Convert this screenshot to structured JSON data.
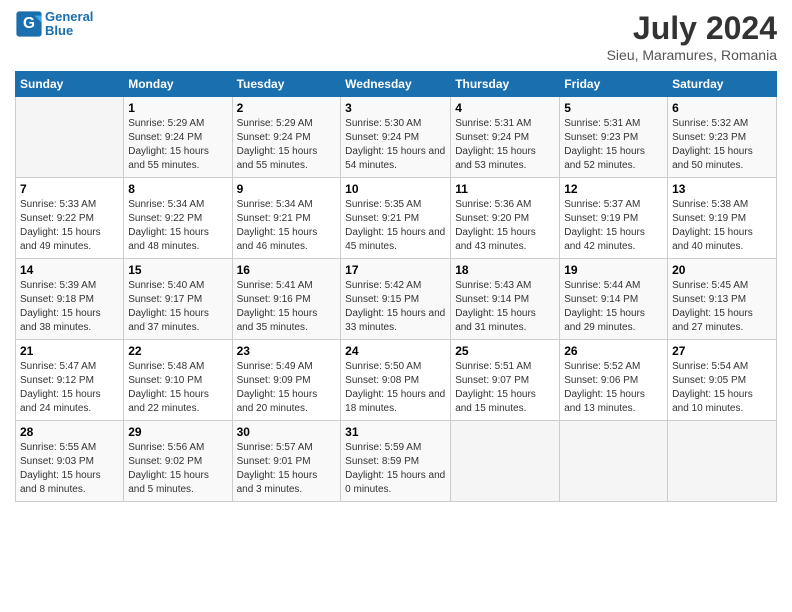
{
  "header": {
    "logo_text_general": "General",
    "logo_text_blue": "Blue",
    "month_year": "July 2024",
    "location": "Sieu, Maramures, Romania"
  },
  "days_of_week": [
    "Sunday",
    "Monday",
    "Tuesday",
    "Wednesday",
    "Thursday",
    "Friday",
    "Saturday"
  ],
  "weeks": [
    [
      null,
      {
        "num": "1",
        "sunrise": "5:29 AM",
        "sunset": "9:24 PM",
        "daylight": "15 hours and 55 minutes."
      },
      {
        "num": "2",
        "sunrise": "5:29 AM",
        "sunset": "9:24 PM",
        "daylight": "15 hours and 55 minutes."
      },
      {
        "num": "3",
        "sunrise": "5:30 AM",
        "sunset": "9:24 PM",
        "daylight": "15 hours and 54 minutes."
      },
      {
        "num": "4",
        "sunrise": "5:31 AM",
        "sunset": "9:24 PM",
        "daylight": "15 hours and 53 minutes."
      },
      {
        "num": "5",
        "sunrise": "5:31 AM",
        "sunset": "9:23 PM",
        "daylight": "15 hours and 52 minutes."
      },
      {
        "num": "6",
        "sunrise": "5:32 AM",
        "sunset": "9:23 PM",
        "daylight": "15 hours and 50 minutes."
      }
    ],
    [
      {
        "num": "7",
        "sunrise": "5:33 AM",
        "sunset": "9:22 PM",
        "daylight": "15 hours and 49 minutes."
      },
      {
        "num": "8",
        "sunrise": "5:34 AM",
        "sunset": "9:22 PM",
        "daylight": "15 hours and 48 minutes."
      },
      {
        "num": "9",
        "sunrise": "5:34 AM",
        "sunset": "9:21 PM",
        "daylight": "15 hours and 46 minutes."
      },
      {
        "num": "10",
        "sunrise": "5:35 AM",
        "sunset": "9:21 PM",
        "daylight": "15 hours and 45 minutes."
      },
      {
        "num": "11",
        "sunrise": "5:36 AM",
        "sunset": "9:20 PM",
        "daylight": "15 hours and 43 minutes."
      },
      {
        "num": "12",
        "sunrise": "5:37 AM",
        "sunset": "9:19 PM",
        "daylight": "15 hours and 42 minutes."
      },
      {
        "num": "13",
        "sunrise": "5:38 AM",
        "sunset": "9:19 PM",
        "daylight": "15 hours and 40 minutes."
      }
    ],
    [
      {
        "num": "14",
        "sunrise": "5:39 AM",
        "sunset": "9:18 PM",
        "daylight": "15 hours and 38 minutes."
      },
      {
        "num": "15",
        "sunrise": "5:40 AM",
        "sunset": "9:17 PM",
        "daylight": "15 hours and 37 minutes."
      },
      {
        "num": "16",
        "sunrise": "5:41 AM",
        "sunset": "9:16 PM",
        "daylight": "15 hours and 35 minutes."
      },
      {
        "num": "17",
        "sunrise": "5:42 AM",
        "sunset": "9:15 PM",
        "daylight": "15 hours and 33 minutes."
      },
      {
        "num": "18",
        "sunrise": "5:43 AM",
        "sunset": "9:14 PM",
        "daylight": "15 hours and 31 minutes."
      },
      {
        "num": "19",
        "sunrise": "5:44 AM",
        "sunset": "9:14 PM",
        "daylight": "15 hours and 29 minutes."
      },
      {
        "num": "20",
        "sunrise": "5:45 AM",
        "sunset": "9:13 PM",
        "daylight": "15 hours and 27 minutes."
      }
    ],
    [
      {
        "num": "21",
        "sunrise": "5:47 AM",
        "sunset": "9:12 PM",
        "daylight": "15 hours and 24 minutes."
      },
      {
        "num": "22",
        "sunrise": "5:48 AM",
        "sunset": "9:10 PM",
        "daylight": "15 hours and 22 minutes."
      },
      {
        "num": "23",
        "sunrise": "5:49 AM",
        "sunset": "9:09 PM",
        "daylight": "15 hours and 20 minutes."
      },
      {
        "num": "24",
        "sunrise": "5:50 AM",
        "sunset": "9:08 PM",
        "daylight": "15 hours and 18 minutes."
      },
      {
        "num": "25",
        "sunrise": "5:51 AM",
        "sunset": "9:07 PM",
        "daylight": "15 hours and 15 minutes."
      },
      {
        "num": "26",
        "sunrise": "5:52 AM",
        "sunset": "9:06 PM",
        "daylight": "15 hours and 13 minutes."
      },
      {
        "num": "27",
        "sunrise": "5:54 AM",
        "sunset": "9:05 PM",
        "daylight": "15 hours and 10 minutes."
      }
    ],
    [
      {
        "num": "28",
        "sunrise": "5:55 AM",
        "sunset": "9:03 PM",
        "daylight": "15 hours and 8 minutes."
      },
      {
        "num": "29",
        "sunrise": "5:56 AM",
        "sunset": "9:02 PM",
        "daylight": "15 hours and 5 minutes."
      },
      {
        "num": "30",
        "sunrise": "5:57 AM",
        "sunset": "9:01 PM",
        "daylight": "15 hours and 3 minutes."
      },
      {
        "num": "31",
        "sunrise": "5:59 AM",
        "sunset": "8:59 PM",
        "daylight": "15 hours and 0 minutes."
      },
      null,
      null,
      null
    ]
  ]
}
